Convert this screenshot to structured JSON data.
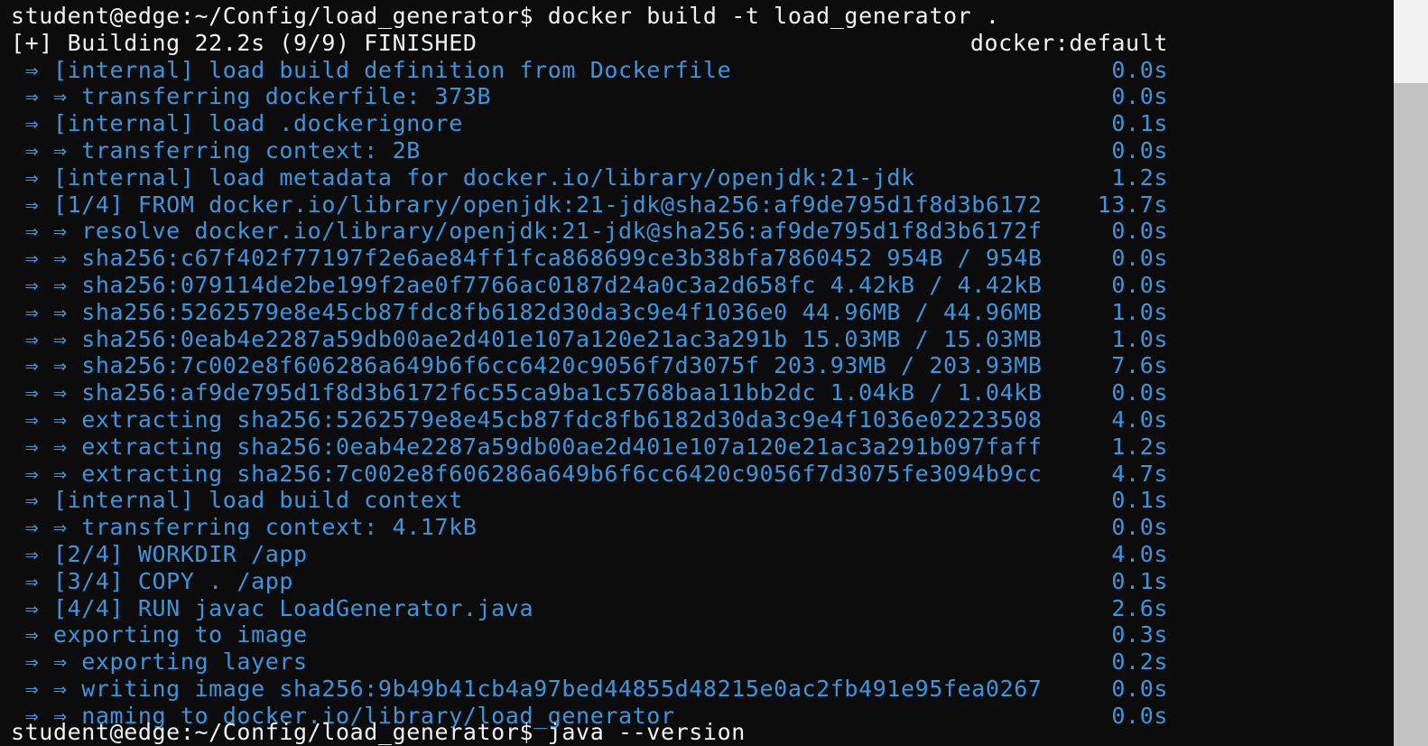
{
  "terminal": {
    "prompt": "student@edge:~/Config/load_generator$ docker build -t load_generator .",
    "header": {
      "text": "[+] Building 22.2s (9/9) FINISHED",
      "right": "docker:default"
    },
    "steps": [
      {
        "text": " ⇒ [internal] load build definition from Dockerfile",
        "time": "0.0s"
      },
      {
        "text": " ⇒ ⇒ transferring dockerfile: 373B",
        "time": "0.0s"
      },
      {
        "text": " ⇒ [internal] load .dockerignore",
        "time": "0.1s"
      },
      {
        "text": " ⇒ ⇒ transferring context: 2B",
        "time": "0.0s"
      },
      {
        "text": " ⇒ [internal] load metadata for docker.io/library/openjdk:21-jdk",
        "time": "1.2s"
      },
      {
        "text": " ⇒ [1/4] FROM docker.io/library/openjdk:21-jdk@sha256:af9de795d1f8d3b6172",
        "time": "13.7s"
      },
      {
        "text": " ⇒ ⇒ resolve docker.io/library/openjdk:21-jdk@sha256:af9de795d1f8d3b6172f",
        "time": "0.0s"
      },
      {
        "text": " ⇒ ⇒ sha256:c67f402f77197f2e6ae84ff1fca868699ce3b38bfa7860452 954B / 954B",
        "time": "0.0s"
      },
      {
        "text": " ⇒ ⇒ sha256:079114de2be199f2ae0f7766ac0187d24a0c3a2d658fc 4.42kB / 4.42kB",
        "time": "0.0s"
      },
      {
        "text": " ⇒ ⇒ sha256:5262579e8e45cb87fdc8fb6182d30da3c9e4f1036e0 44.96MB / 44.96MB",
        "time": "1.0s"
      },
      {
        "text": " ⇒ ⇒ sha256:0eab4e2287a59db00ae2d401e107a120e21ac3a291b 15.03MB / 15.03MB",
        "time": "1.0s"
      },
      {
        "text": " ⇒ ⇒ sha256:7c002e8f606286a649b6f6cc6420c9056f7d3075f 203.93MB / 203.93MB",
        "time": "7.6s"
      },
      {
        "text": " ⇒ ⇒ sha256:af9de795d1f8d3b6172f6c55ca9ba1c5768baa11bb2dc 1.04kB / 1.04kB",
        "time": "0.0s"
      },
      {
        "text": " ⇒ ⇒ extracting sha256:5262579e8e45cb87fdc8fb6182d30da3c9e4f1036e02223508",
        "time": "4.0s"
      },
      {
        "text": " ⇒ ⇒ extracting sha256:0eab4e2287a59db00ae2d401e107a120e21ac3a291b097faff",
        "time": "1.2s"
      },
      {
        "text": " ⇒ ⇒ extracting sha256:7c002e8f606286a649b6f6cc6420c9056f7d3075fe3094b9cc",
        "time": "4.7s"
      },
      {
        "text": " ⇒ [internal] load build context",
        "time": "0.1s"
      },
      {
        "text": " ⇒ ⇒ transferring context: 4.17kB",
        "time": "0.0s"
      },
      {
        "text": " ⇒ [2/4] WORKDIR /app",
        "time": "4.0s"
      },
      {
        "text": " ⇒ [3/4] COPY . /app",
        "time": "0.1s"
      },
      {
        "text": " ⇒ [4/4] RUN javac LoadGenerator.java",
        "time": "2.6s"
      },
      {
        "text": " ⇒ exporting to image",
        "time": "0.3s"
      },
      {
        "text": " ⇒ ⇒ exporting layers",
        "time": "0.2s"
      },
      {
        "text": " ⇒ ⇒ writing image sha256:9b49b41cb4a97bed44855d48215e0ac2fb491e95fea0267",
        "time": "0.0s"
      },
      {
        "text": " ⇒ ⇒ naming to docker.io/library/load_generator",
        "time": "0.0s"
      }
    ],
    "next_prompt": "student@edge:~/Config/load_generator$ java --version"
  },
  "colors": {
    "background": "#0c0c0c",
    "foreground": "#f2f2f2",
    "step_blue": "#3a96dd",
    "scrollbar_track": "#f0f0f0",
    "scrollbar_thumb": "#c2c2c2"
  }
}
